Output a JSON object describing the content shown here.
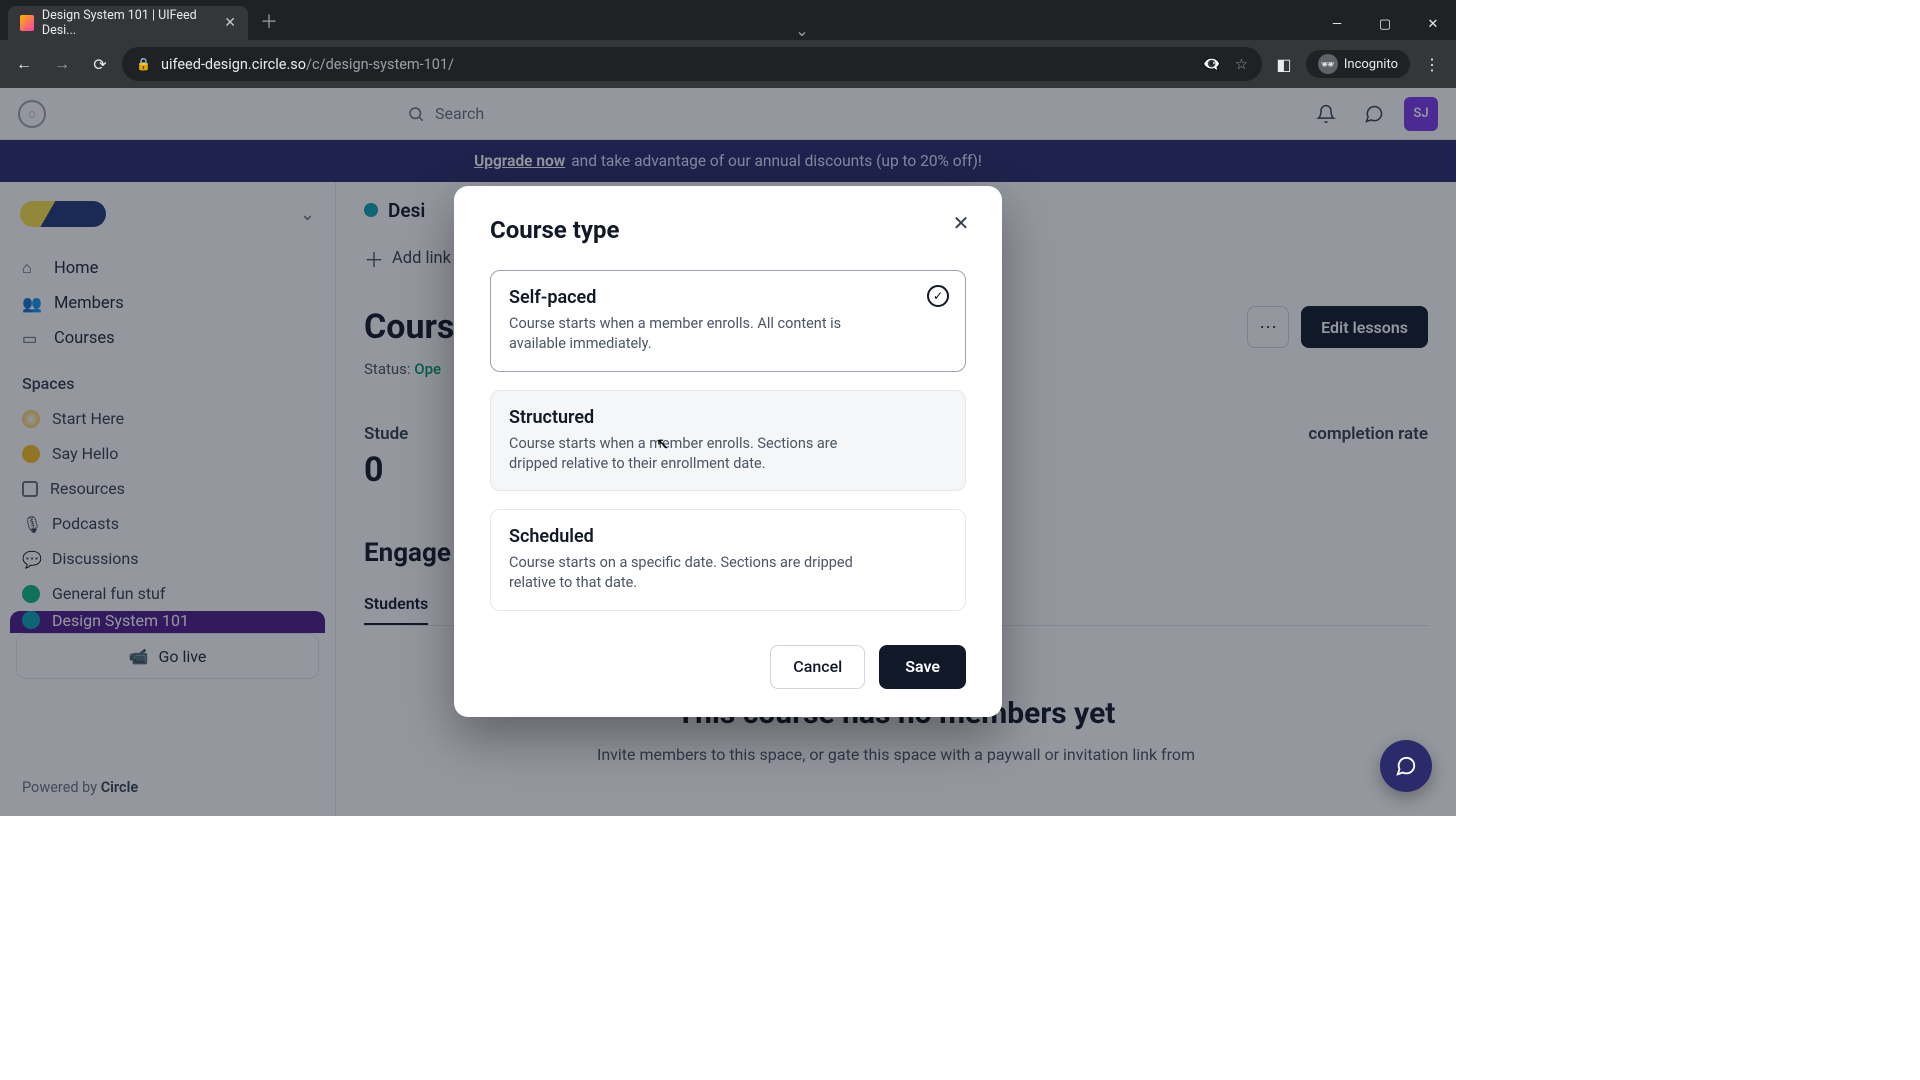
{
  "browser": {
    "tab_title": "Design System 101 | UIFeed Desi...",
    "url_host": "uifeed-design.circle.so",
    "url_path": "/c/design-system-101/",
    "incognito_label": "Incognito"
  },
  "topbar": {
    "search_placeholder": "Search",
    "avatar_initials": "SJ"
  },
  "banner": {
    "upgrade": "Upgrade now",
    "rest": " and take advantage of our annual discounts (up to 20% off)!"
  },
  "sidebar": {
    "nav": {
      "home": "Home",
      "members": "Members",
      "courses": "Courses"
    },
    "spaces_heading": "Spaces",
    "spaces": {
      "start_here": "Start Here",
      "say_hello": "Say Hello",
      "resources": "Resources",
      "podcasts": "Podcasts",
      "discussions": "Discussions",
      "general_fun": "General fun stuf",
      "design_system": "Design System 101"
    },
    "go_live": "Go live",
    "powered_prefix": "Powered by ",
    "powered_brand": "Circle"
  },
  "main": {
    "crumb_title": "Desi",
    "add_link": "Add link",
    "page_title": "Cours",
    "more_button": "⋯",
    "edit_lessons": "Edit lessons",
    "status_label": "Status: ",
    "status_value": "Ope",
    "stats": {
      "students_label": "Stude",
      "students_value": "0",
      "completion_label": "completion rate"
    },
    "engagement_heading": "Engage",
    "tabs": {
      "students": "Students"
    },
    "empty_heading": "This course has no members yet",
    "empty_body": "Invite members to this space, or gate this space with a paywall or invitation link from"
  },
  "modal": {
    "title": "Course type",
    "options": [
      {
        "title": "Self-paced",
        "desc": "Course starts when a member enrolls. All content is available immediately.",
        "selected": true
      },
      {
        "title": "Structured",
        "desc": "Course starts when a member enrolls. Sections are dripped relative to their enrollment date.",
        "hover": true
      },
      {
        "title": "Scheduled",
        "desc": "Course starts on a specific date. Sections are dripped relative to that date."
      }
    ],
    "cancel": "Cancel",
    "save": "Save"
  }
}
